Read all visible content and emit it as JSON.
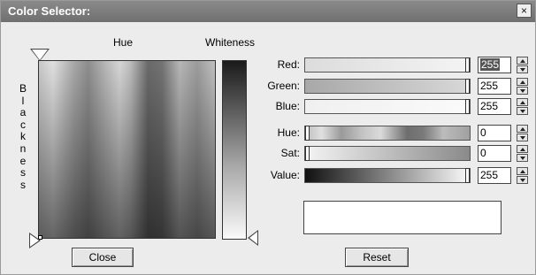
{
  "window": {
    "title": "Color Selector:",
    "close_glyph": "×"
  },
  "picker": {
    "hue_label": "Hue",
    "whiteness_label": "Whiteness",
    "blackness_letters": [
      "B",
      "l",
      "a",
      "c",
      "k",
      "n",
      "e",
      "s",
      "s"
    ]
  },
  "sliders": [
    {
      "label": "Red:",
      "value": "255",
      "level": 1.0,
      "selected": true
    },
    {
      "label": "Green:",
      "value": "255",
      "level": 1.0,
      "selected": false
    },
    {
      "label": "Blue:",
      "value": "255",
      "level": 1.0,
      "selected": false
    },
    {
      "label": "Hue:",
      "value": "0",
      "level": 0.0,
      "selected": false
    },
    {
      "label": "Sat:",
      "value": "0",
      "level": 0.0,
      "selected": false
    },
    {
      "label": "Value:",
      "value": "255",
      "level": 1.0,
      "selected": false
    }
  ],
  "preview": {
    "color": "#ffffff"
  },
  "buttons": {
    "close": "Close",
    "reset": "Reset"
  }
}
